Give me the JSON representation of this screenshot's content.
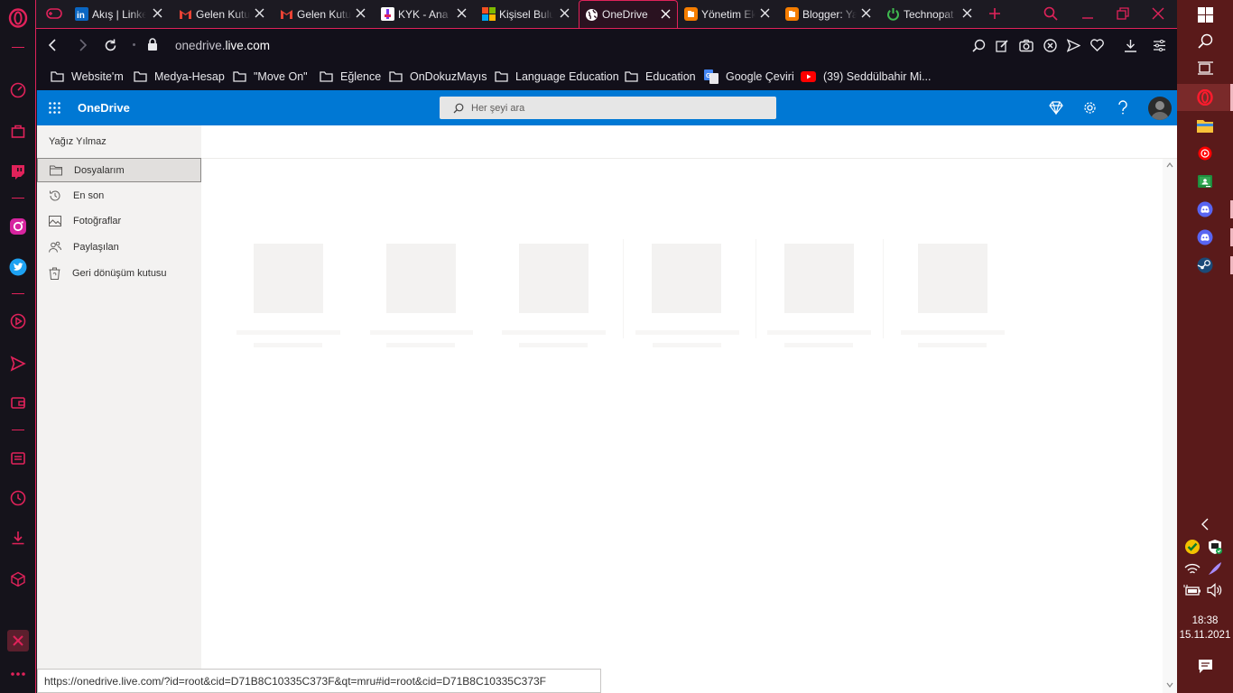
{
  "tabs": [
    {
      "label": "Akış | Linke",
      "icon": "linkedin-icon",
      "color": "#0a66c2"
    },
    {
      "label": "Gelen Kutu",
      "icon": "gmail-icon",
      "color": "#ea4335"
    },
    {
      "label": "Gelen Kutu",
      "icon": "gmail-icon",
      "color": "#ea4335"
    },
    {
      "label": "KYK - Ana",
      "icon": "kyk-icon",
      "color": "#ffffff"
    },
    {
      "label": "Kişisel Bulu",
      "icon": "microsoft-icon",
      "color": "#f25022"
    },
    {
      "label": "OneDrive",
      "icon": "globe-icon",
      "color": "#ffffff",
      "active": true
    },
    {
      "label": "Yönetim Ek",
      "icon": "blogger-icon",
      "color": "#f57d00"
    },
    {
      "label": "Blogger: Ya",
      "icon": "blogger-icon",
      "color": "#f57d00"
    },
    {
      "label": "Technopat",
      "icon": "power-icon",
      "color": "#3fb950"
    }
  ],
  "address": {
    "domain_prefix": "onedrive.",
    "domain_main": "live.com"
  },
  "bookmarks": [
    {
      "label": "Website'm",
      "icon": "folder-icon"
    },
    {
      "label": "Medya-Hesap",
      "icon": "folder-icon"
    },
    {
      "label": "\"Move On\"",
      "icon": "folder-icon"
    },
    {
      "label": "Eğlence",
      "icon": "folder-icon"
    },
    {
      "label": "OnDokuzMayıs",
      "icon": "folder-icon"
    },
    {
      "label": "Language Education",
      "icon": "folder-icon"
    },
    {
      "label": "Education",
      "icon": "folder-icon"
    },
    {
      "label": "Google Çeviri",
      "icon": "google-translate-icon"
    },
    {
      "label": "(39) Seddülbahir Mi...",
      "icon": "youtube-icon"
    }
  ],
  "onedrive": {
    "title": "OneDrive",
    "search_placeholder": "Her şeyi ara",
    "user": "Yağız Yılmaz",
    "nav": [
      {
        "label": "Dosyalarım",
        "icon": "folder-icon",
        "selected": true
      },
      {
        "label": "En son",
        "icon": "history-icon"
      },
      {
        "label": "Fotoğraflar",
        "icon": "image-icon"
      },
      {
        "label": "Paylaşılan",
        "icon": "people-icon"
      },
      {
        "label": "Geri dönüşüm kutusu",
        "icon": "recycle-bin-icon"
      }
    ]
  },
  "status_url": "https://onedrive.live.com/?id=root&cid=D71B8C10335C373F&qt=mru#id=root&cid=D71B8C10335C373F",
  "clock": {
    "time": "18:38",
    "date": "15.11.2021"
  },
  "colors": {
    "opera_accent": "#e0225a",
    "onedrive_blue": "#0078d4",
    "taskbar": "#5a1a1a"
  }
}
